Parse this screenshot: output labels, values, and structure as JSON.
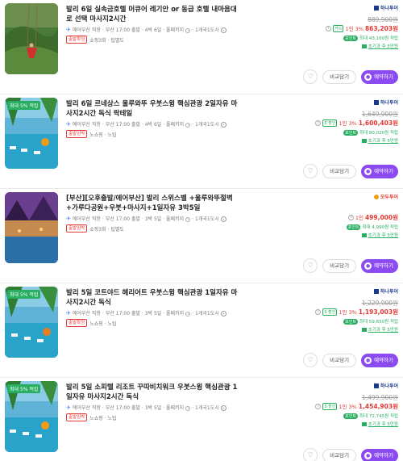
{
  "products": [
    {
      "title": "발리 6일 실속금호텔 머큐어 레기안 or 동급 호텔 내마음대로 선택 마사지2시간",
      "badge": "",
      "airline": "에어부산 직항",
      "schedule": "부산 17:00 출발 · 4박 6일 · 풀패키지",
      "countries": "1개국1도시",
      "tag": "출발확정",
      "extras": "쇼핑3회 · 팁별도",
      "vendor": "하나투어",
      "vendor_color": "#1a3a8f",
      "original_price": "889,900원",
      "card_badge": "카드",
      "discount_text": "1인 3%",
      "final_price": "863,203원",
      "points_badge": "포인트",
      "points_text": "최대 43,160원 적립",
      "balance_text": "초기과 후 5만원",
      "compare_label": "비교담기",
      "book_label": "예약하기"
    },
    {
      "title": "발리 6일 르네상스 울루와뚜 우붓스윙 핵심관광 2일자유 마사지2시간 독식 락테일",
      "badge": "최대 5% 적립",
      "airline": "에어부산 직항",
      "schedule": "부산 17:00 출발 · 4박 6일 · 풀패키지",
      "countries": "1개국1도시",
      "tag": "출발임박",
      "extras": "노쇼핑 · 노팁",
      "vendor": "하나투어",
      "vendor_color": "#1a3a8f",
      "original_price": "1,649,900원",
      "card_badge": "S 할인",
      "discount_text": "1인 3%",
      "final_price": "1,600,403원",
      "points_badge": "포인트",
      "points_text": "최대 80,020원 적립",
      "balance_text": "초기과 후 5만원",
      "compare_label": "비교담기",
      "book_label": "예약하기"
    },
    {
      "title": "[부산][오후출발/에어부산] 발리 스위스벨 +울루와뚜절벽+가루다공원+우붓+마사지+1일자유 3박5일",
      "badge": "",
      "airline": "에어부산 직항",
      "schedule": "부산 17:00 출발 · 3박 5일 · 풀패키지",
      "countries": "1개국1도시",
      "tag": "출발임박",
      "extras": "쇼핑3회 · 팁별도",
      "vendor": "모두투어",
      "vendor_color": "#e53935",
      "original_price": "",
      "card_badge": "",
      "discount_text": "1인",
      "final_price": "499,000원",
      "points_badge": "포인트",
      "points_text": "최대 4,990원 적립",
      "balance_text": "초기과 후 5만원",
      "compare_label": "비교담기",
      "book_label": "예약하기"
    },
    {
      "title": "발리 5일 코트야드 헤리어트 우붓스윙 핵심관광 1일자유 마사지2시간 독식",
      "badge": "최대 5% 적립",
      "airline": "에어부산 직항",
      "schedule": "부산 17:00 출발 · 3박 5일 · 풀패키지",
      "countries": "1개국1도시",
      "tag": "출발확정",
      "extras": "노쇼핑 · 노팁",
      "vendor": "하나투어",
      "vendor_color": "#1a3a8f",
      "original_price": "1,229,900원",
      "card_badge": "S 할인",
      "discount_text": "1인 3%",
      "final_price": "1,193,003원",
      "points_badge": "포인트",
      "points_text": "최대 59,650원 적립",
      "balance_text": "초기과 후 5만원",
      "compare_label": "비교담기",
      "book_label": "예약하기"
    },
    {
      "title": "발리 5일 소피텔 리조트 꾸따비치워크 우붓스윙 핵심관광 1일자유 마사지2시간 독식",
      "badge": "최대 5% 적립",
      "airline": "에어부산 직항",
      "schedule": "부산 17:00 출발 · 3박 5일 · 풀패키지",
      "countries": "1개국1도시",
      "tag": "출발임박",
      "extras": "노쇼핑 · 노팁",
      "vendor": "하나투어",
      "vendor_color": "#1a3a8f",
      "original_price": "1,499,900원",
      "card_badge": "S 할인",
      "discount_text": "1인 3%",
      "final_price": "1,454,903원",
      "points_badge": "포인트",
      "points_text": "최대 72,745원 적립",
      "balance_text": "초기과 후 5만원",
      "compare_label": "비교담기",
      "book_label": "예약하기"
    }
  ]
}
